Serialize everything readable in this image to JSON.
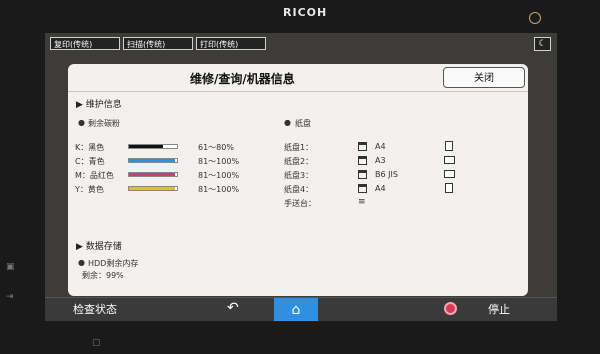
{
  "device": {
    "brand": "RICOH"
  },
  "mode_tabs": [
    {
      "label": "复印(传统)"
    },
    {
      "label": "扫描(传统)"
    },
    {
      "label": "打印(传统)"
    }
  ],
  "panel": {
    "title": "维修/查询/机器信息",
    "close_label": "关闭",
    "maintenance_title": "▶ 维护信息",
    "toner": {
      "title": "剩余碳粉",
      "items": [
        {
          "label": "K：黑色",
          "range": "61～80%",
          "color": "#111111",
          "fill_pct": 70
        },
        {
          "label": "C：青色",
          "range": "81～100%",
          "color": "#2f8fe0",
          "fill_pct": 95
        },
        {
          "label": "M：品红色",
          "range": "81～100%",
          "color": "#d03a7a",
          "fill_pct": 95
        },
        {
          "label": "Y：黄色",
          "range": "81～100%",
          "color": "#e3c21e",
          "fill_pct": 95
        }
      ]
    },
    "paper": {
      "title": "纸盘",
      "trays": [
        {
          "label": "纸盘1：",
          "size": "A4"
        },
        {
          "label": "纸盘2：",
          "size": "A3"
        },
        {
          "label": "纸盘3：",
          "size": "B6 JIS"
        },
        {
          "label": "纸盘4：",
          "size": "A4"
        }
      ],
      "manual": "手送台："
    },
    "storage_title": "▶ 数据存储",
    "hdd": {
      "title": "HDD剩余内存",
      "remain": "剩余：99%"
    }
  },
  "bottom": {
    "status_label": "检查状态",
    "back_icon": "↶",
    "home_icon": "⌂",
    "stop_label": "停止"
  }
}
